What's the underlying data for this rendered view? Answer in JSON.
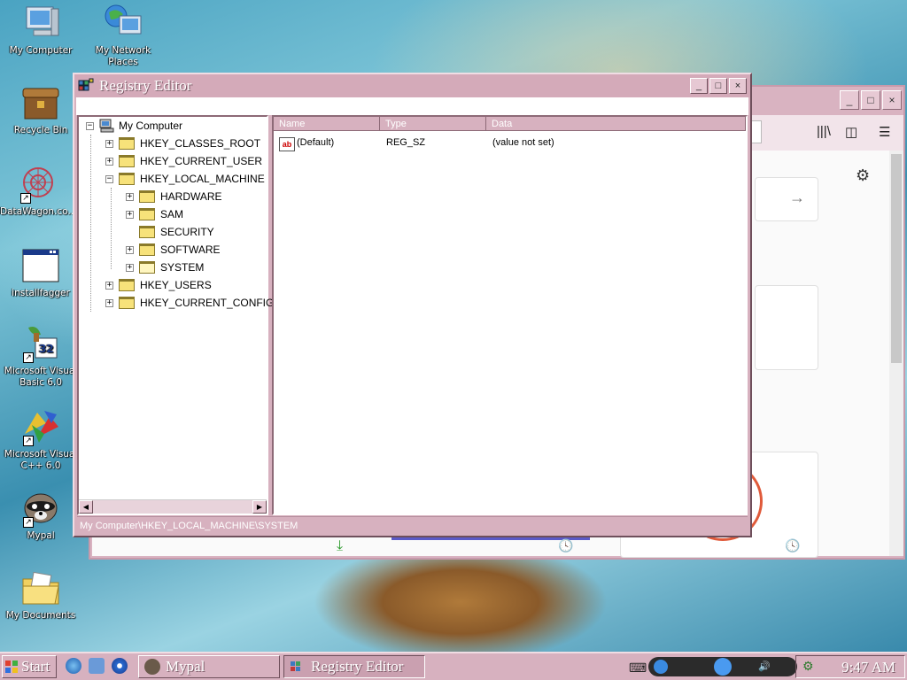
{
  "desktop": {
    "icons": [
      {
        "label": "My Computer",
        "icon": "my-computer-icon"
      },
      {
        "label": "My Network Places",
        "icon": "network-places-icon"
      },
      {
        "label": "Recycle Bin",
        "icon": "recycle-bin-icon"
      },
      {
        "label": "DataWagon.co...",
        "icon": "datawagon-icon"
      },
      {
        "label": "installfagger",
        "icon": "application-window-icon"
      },
      {
        "label": "Microsoft Visual Basic 6.0",
        "icon": "visual-basic-icon"
      },
      {
        "label": "Microsoft Visual C++ 6.0",
        "icon": "visual-cpp-icon"
      },
      {
        "label": "Mypal",
        "icon": "mypal-raccoon-icon"
      },
      {
        "label": "My Documents",
        "icon": "my-documents-folder-icon"
      }
    ]
  },
  "registry_editor": {
    "title": "Registry Editor",
    "controls": {
      "minimize": "_",
      "maximize": "□",
      "close": "×"
    },
    "tree": {
      "root": "My Computer",
      "items": [
        {
          "label": "HKEY_CLASSES_ROOT",
          "expander": "+"
        },
        {
          "label": "HKEY_CURRENT_USER",
          "expander": "+"
        },
        {
          "label": "HKEY_LOCAL_MACHINE",
          "expander": "−"
        },
        {
          "label": "HARDWARE",
          "expander": "+"
        },
        {
          "label": "SAM",
          "expander": "+"
        },
        {
          "label": "SECURITY",
          "expander": ""
        },
        {
          "label": "SOFTWARE",
          "expander": "+"
        },
        {
          "label": "SYSTEM",
          "expander": "+"
        },
        {
          "label": "HKEY_USERS",
          "expander": "+"
        },
        {
          "label": "HKEY_CURRENT_CONFIG",
          "expander": "+"
        }
      ]
    },
    "list": {
      "columns": [
        "Name",
        "Type",
        "Data"
      ],
      "rows": [
        {
          "icon": "ab",
          "name": "(Default)",
          "type": "REG_SZ",
          "data": "(value not set)"
        }
      ]
    },
    "status": "My Computer\\HKEY_LOCAL_MACHINE\\SYSTEM"
  },
  "taskbar": {
    "start_label": "Start",
    "tasks": [
      {
        "label": "Mypal",
        "active": false
      },
      {
        "label": "Registry Editor",
        "active": true
      }
    ],
    "clock": "9:47 AM"
  },
  "colors": {
    "theme_pink": "#d7b1bf",
    "title_text": "#ffffff"
  }
}
